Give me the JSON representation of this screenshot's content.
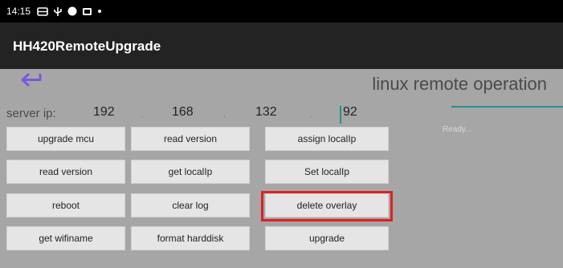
{
  "status_bar": {
    "time": "14:15"
  },
  "app_bar": {
    "title": "HH420RemoteUpgrade"
  },
  "header": {
    "operation_title": "linux remote operation"
  },
  "server_ip": {
    "label": "server ip:",
    "octets": [
      "192",
      "168",
      "132",
      "92"
    ]
  },
  "status": {
    "text": "Ready..."
  },
  "buttons": {
    "row1": [
      "upgrade mcu",
      "read version",
      "assign localIp"
    ],
    "row2": [
      "read version",
      "get localIp",
      "Set localIp"
    ],
    "row3": [
      "reboot",
      "clear log",
      "delete overlay"
    ],
    "row4": [
      "get wifiname",
      "format harddisk",
      "upgrade"
    ]
  },
  "colors": {
    "accent": "#2a8e8e",
    "back_arrow": "#7b57d9",
    "highlight": "#e02020"
  }
}
